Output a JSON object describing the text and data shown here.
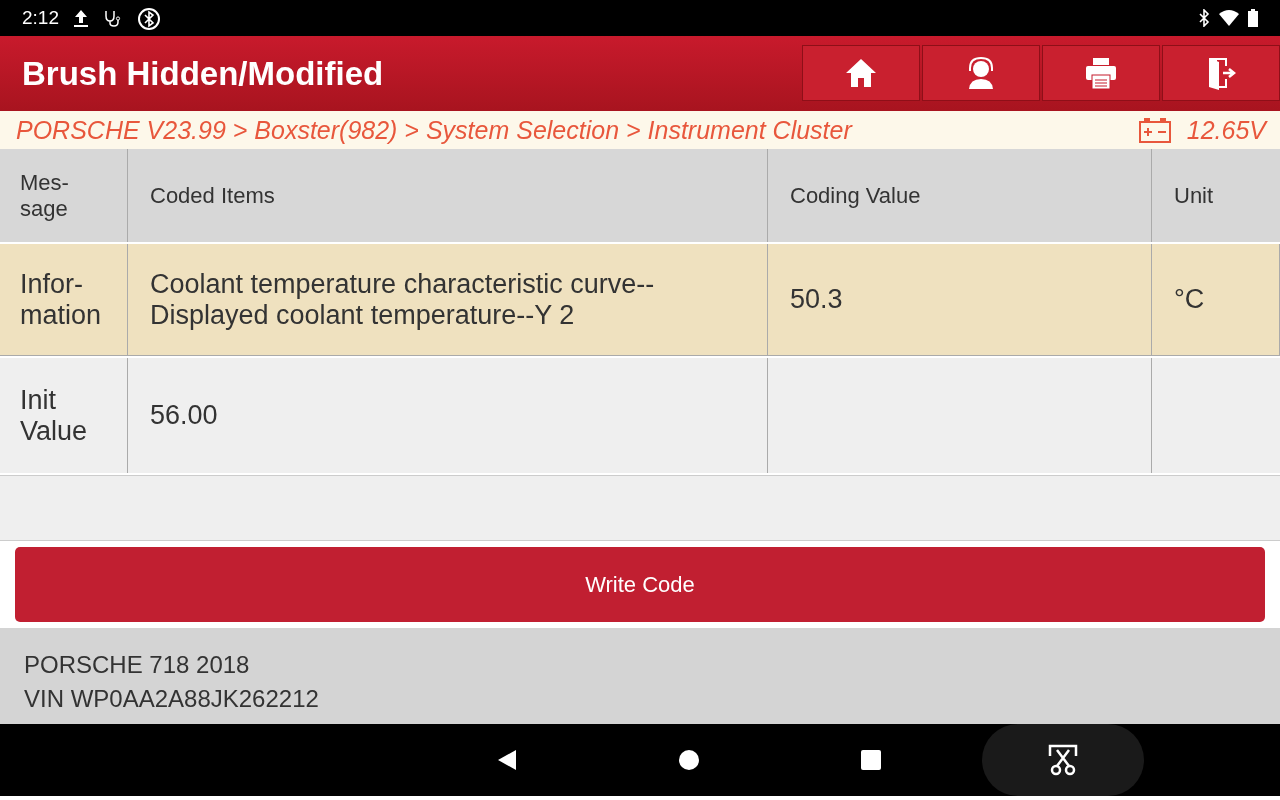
{
  "status_bar": {
    "time": "2:12"
  },
  "header": {
    "title": "Brush Hidden/Modified",
    "buttons": [
      {
        "kind": "home"
      },
      {
        "kind": "support"
      },
      {
        "kind": "print"
      },
      {
        "kind": "exit"
      }
    ]
  },
  "breadcrumb": {
    "path": "PORSCHE V23.99 > Boxster(982) > System Selection > Instrument Cluster",
    "voltage": "12.65V"
  },
  "table": {
    "columns": [
      "Mes-sage",
      "Coded Items",
      "Coding Value",
      "Unit"
    ],
    "rows": [
      {
        "cells": [
          "Infor-mation",
          "Coolant temperature characteristic curve--Displayed coolant temperature--Y 2",
          "50.3",
          "°C"
        ],
        "selected": true
      },
      {
        "cells": [
          "Init Value",
          "56.00",
          "",
          ""
        ],
        "selected": false
      }
    ]
  },
  "write_button": "Write Code",
  "vehicle": {
    "model": "PORSCHE 718 2018",
    "vin": "VIN WP0AA2A88JK262212"
  }
}
